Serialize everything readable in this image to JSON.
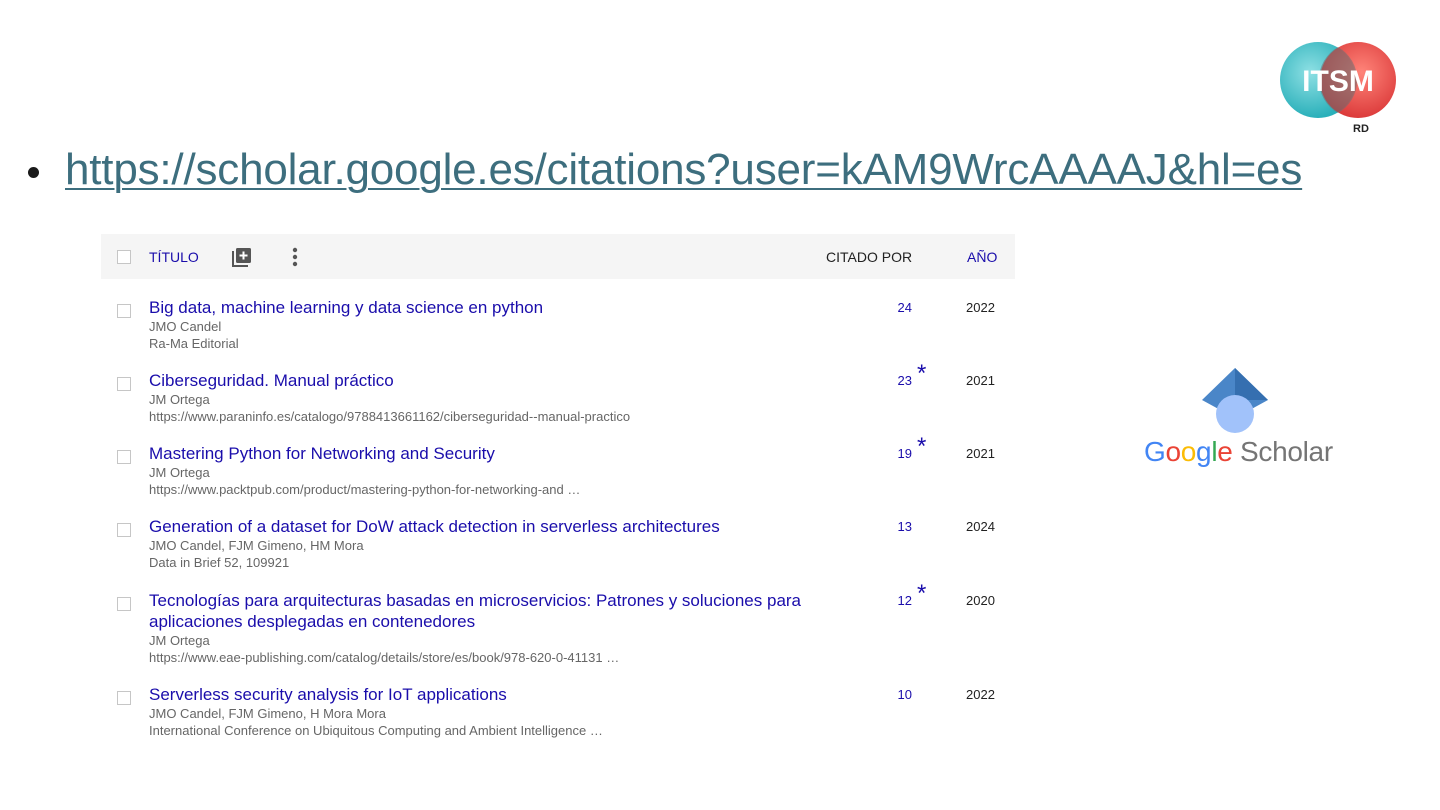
{
  "logo": {
    "text": "ITSM",
    "subtext": "RD",
    "colors": [
      "#39c0c9",
      "#e03a3a"
    ]
  },
  "bullet": {
    "url": "https://scholar.google.es/citations?user=kAM9WrcAAAAJ&hl=es"
  },
  "table": {
    "headers": {
      "title": "TÍTULO",
      "cited_by": "CITADO POR",
      "year": "AÑO"
    },
    "rows": [
      {
        "title": "Big data, machine learning y data science en python",
        "authors": "JMO Candel",
        "venue": "Ra-Ma Editorial",
        "cites": "24",
        "star": "",
        "year": "2022"
      },
      {
        "title": "Ciberseguridad. Manual práctico",
        "authors": "JM Ortega",
        "venue": "https://www.paraninfo.es/catalogo/9788413661162/ciberseguridad--manual-practico",
        "cites": "23",
        "star": "*",
        "year": "2021"
      },
      {
        "title": "Mastering Python for Networking and Security",
        "authors": "JM Ortega",
        "venue": "https://www.packtpub.com/product/mastering-python-for-networking-and …",
        "cites": "19",
        "star": "*",
        "year": "2021"
      },
      {
        "title": "Generation of a dataset for DoW attack detection in serverless architectures",
        "authors": "JMO Candel, FJM Gimeno, HM Mora",
        "venue": "Data in Brief 52, 109921",
        "cites": "13",
        "star": "",
        "year": "2024"
      },
      {
        "title": "Tecnologías para arquitecturas basadas en microservicios: Patrones y soluciones para aplicaciones desplegadas en contenedores",
        "authors": "JM Ortega",
        "venue": "https://www.eae-publishing.com/catalog/details/store/es/book/978-620-0-41131 …",
        "cites": "12",
        "star": "*",
        "year": "2020"
      },
      {
        "title": "Serverless security analysis for IoT applications",
        "authors": "JMO Candel, FJM Gimeno, H Mora Mora",
        "venue": "International Conference on Ubiquitous Computing and Ambient Intelligence …",
        "cites": "10",
        "star": "",
        "year": "2022"
      }
    ]
  },
  "google_scholar": {
    "letters": [
      {
        "ch": "G",
        "color": "#4285f4"
      },
      {
        "ch": "o",
        "color": "#ea4335"
      },
      {
        "ch": "o",
        "color": "#fbbc05"
      },
      {
        "ch": "g",
        "color": "#4285f4"
      },
      {
        "ch": "l",
        "color": "#34a853"
      },
      {
        "ch": "e",
        "color": "#ea4335"
      }
    ],
    "word": "Scholar",
    "word_color": "#757575"
  }
}
